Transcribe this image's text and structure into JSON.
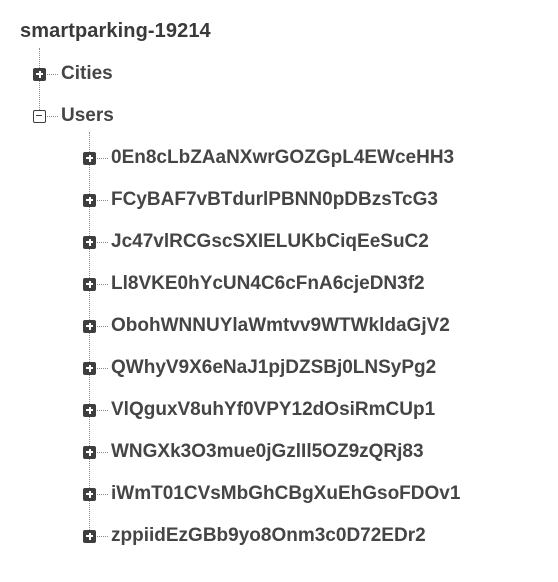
{
  "tree": {
    "root": "smartparking-19214",
    "nodes": [
      {
        "label": "Cities",
        "state": "collapsed"
      },
      {
        "label": "Users",
        "state": "expanded"
      }
    ],
    "users": [
      "0En8cLbZAaNXwrGOZGpL4EWceHH3",
      "FCyBAF7vBTdurlPBNN0pDBzsTcG3",
      "Jc47vlRCGscSXIELUKbCiqEeSuC2",
      "Ll8VKE0hYcUN4C6cFnA6cjeDN3f2",
      "ObohWNNUYlaWmtvv9WTWkldaGjV2",
      "QWhyV9X6eNaJ1pjDZSBj0LNSyPg2",
      "VlQguxV8uhYf0VPY12dOsiRmCUp1",
      "WNGXk3O3mue0jGzlIl5OZ9zQRj83",
      "iWmT01CVsMbGhCBgXuEhGsoFDOv1",
      "zppiidEzGBb9yo8Onm3c0D72EDr2"
    ]
  }
}
